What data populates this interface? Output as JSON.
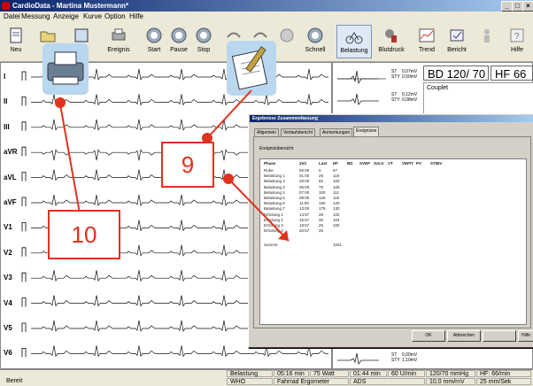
{
  "window": {
    "title": "CardioData - Martina Mustermann*",
    "min_btn": "_",
    "max_btn": "□",
    "close_btn": "×"
  },
  "menu": [
    "Datei",
    "Messung",
    "Anzeige",
    "Kurve",
    "Option",
    "Hilfe"
  ],
  "toolbar": [
    {
      "label": "Neu",
      "icon": "page-icon"
    },
    {
      "label": "",
      "icon": "folder-icon"
    },
    {
      "label": "ern",
      "icon": "doc-icon"
    },
    {
      "label": "Ereignis",
      "icon": "printer-icon"
    },
    {
      "label": "Start",
      "icon": "record-icon"
    },
    {
      "label": "Pause",
      "icon": "pause-icon"
    },
    {
      "label": "Stop",
      "icon": "stop-icon"
    },
    {
      "label": "",
      "icon": "arrow-icon"
    },
    {
      "label": "",
      "icon": "arrow-icon"
    },
    {
      "label": "",
      "icon": "circle-icon"
    },
    {
      "label": "Schnell",
      "icon": "fast-icon"
    },
    {
      "label": "Belastung",
      "icon": "bike-icon"
    },
    {
      "label": "Blutdruck",
      "icon": "pressure-icon"
    },
    {
      "label": "Trend",
      "icon": "trend-icon"
    },
    {
      "label": "Bericht",
      "icon": "report-icon"
    },
    {
      "label": "",
      "icon": "person-icon"
    },
    {
      "label": "Hilfe",
      "icon": "help-icon"
    }
  ],
  "leads": [
    "I",
    "II",
    "III",
    "aVR",
    "aVL",
    "aVF",
    "V1",
    "V2",
    "V3",
    "V4",
    "V5",
    "V6"
  ],
  "right_panel": {
    "bp": "BD 120/ 70",
    "hf": "HF  66",
    "couplet": "Couplet",
    "st_rows": [
      {
        "a": "ST",
        "b": "0,07mV",
        "c": "STY",
        "d": "0,50mV"
      },
      {
        "a": "ST",
        "b": "0,12mV",
        "c": "STY",
        "d": "0,08mV"
      },
      {
        "a": "ST",
        "b": "0,00mV",
        "c": "STY",
        "d": "1,10mV"
      }
    ]
  },
  "dialog": {
    "title": "Ergebnisse Zusammenfassung",
    "tabs": [
      "Allgemein",
      "Verlaufsbericht",
      "Anmerkungen",
      "Ereignisse"
    ],
    "table_title": "Ereignisübersicht",
    "headers": [
      "Phase",
      "Zeit",
      "Last",
      "HF",
      "BD",
      "SVEP",
      "SALV",
      "VT",
      "VEP/T",
      "PV",
      "ST/BV"
    ],
    "rows": [
      [
        "Ruhe",
        "00:00",
        "0",
        "57"
      ],
      [
        "Belastung 1",
        "01:00",
        "25",
        "118"
      ],
      [
        "Belastung 2",
        "03:00",
        "50",
        "103"
      ],
      [
        "Belastung 3",
        "05:00",
        "75",
        "106"
      ],
      [
        "Belastung 4",
        "07:00",
        "100",
        "111"
      ],
      [
        "Belastung 5",
        "09:00",
        "125",
        "115"
      ],
      [
        "Belastung 6",
        "11:00",
        "150",
        "120"
      ],
      [
        "Belastung 7",
        "13:00",
        "175",
        "130"
      ],
      [
        "Erholung 1",
        "14:57",
        "25",
        "102"
      ],
      [
        "Erholung 2",
        "16:57",
        "25",
        "104"
      ],
      [
        "Erholung 3",
        "18:57",
        "25",
        "100"
      ],
      [
        "Erholung 4",
        "20:57",
        "25",
        ""
      ],
      [
        "Summe",
        "",
        "",
        "1041"
      ]
    ],
    "buttons": [
      "OK",
      "Abbrechen",
      "",
      "Hilfe"
    ]
  },
  "status": {
    "ready": "Bereit",
    "phase": "Belastung",
    "time": "05:16 min",
    "watt": "75 Watt",
    "time2": "01:44 min",
    "rate": "60 U/min",
    "bp": "120/70 mmHg",
    "hf": "HF: 66/min",
    "who": "WHO",
    "ergometer": "Fahrrad Ergometer",
    "ads": "ADS",
    "gain": "10,0 mm/mV",
    "speed": "25 mm/Sek"
  },
  "callouts": [
    "10",
    "9"
  ],
  "colors": {
    "callout_red": "#e0321c",
    "titlebar": "#0a246a"
  }
}
